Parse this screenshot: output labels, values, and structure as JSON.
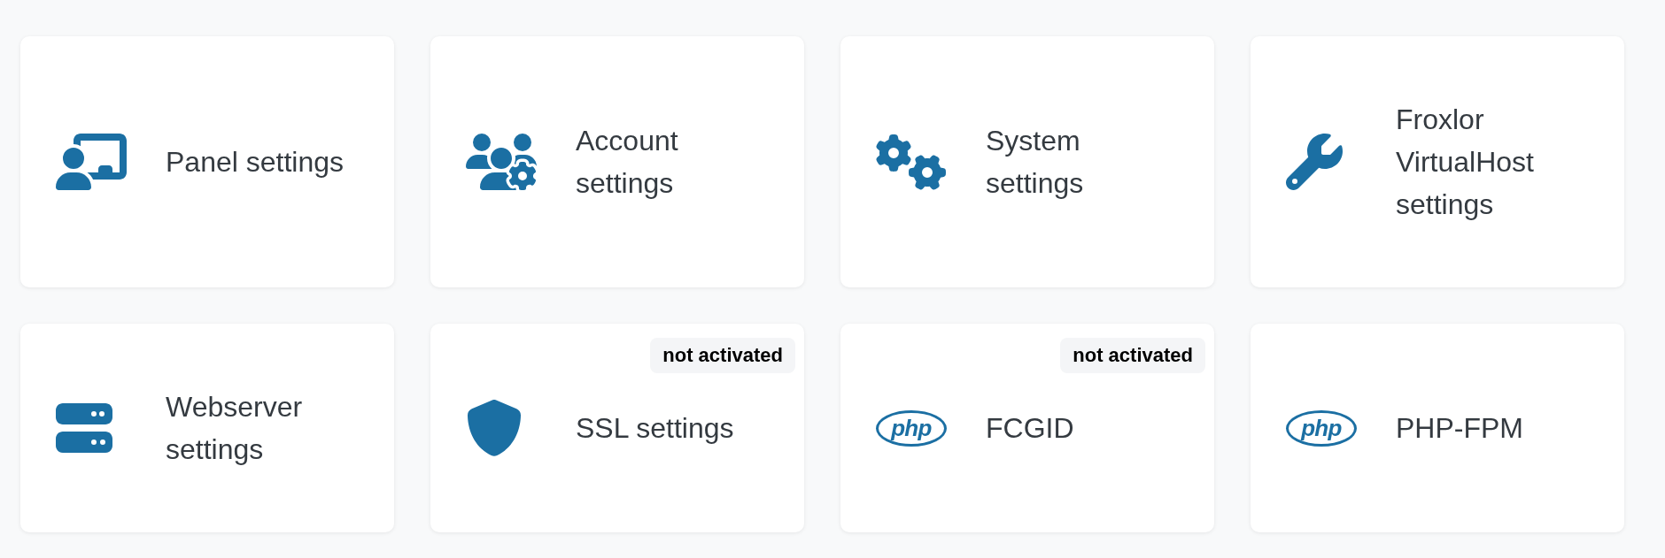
{
  "cards": [
    {
      "kind": "icon",
      "title": "Panel settings"
    },
    {
      "kind": "icon",
      "title": "Account settings"
    },
    {
      "kind": "icon",
      "title": "System settings"
    },
    {
      "kind": "icon",
      "title": "Froxlor VirtualHost settings"
    },
    {
      "kind": "icon",
      "title": "Webserver settings"
    },
    {
      "kind": "icon",
      "title": "SSL settings",
      "badge": "not activated"
    },
    {
      "kind": "logo",
      "logo_text": "php",
      "title": "FCGID",
      "badge": "not activated"
    },
    {
      "kind": "logo",
      "logo_text": "php",
      "title": "PHP-FPM"
    }
  ]
}
